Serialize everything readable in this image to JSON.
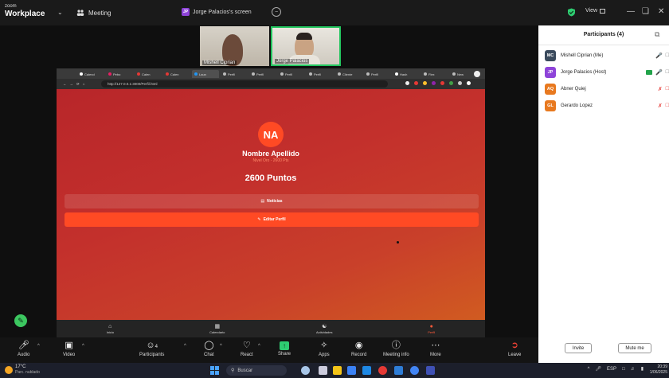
{
  "window": {
    "logo_line1": "zoom",
    "logo_line2": "Workplace",
    "meeting_label": "Meeting",
    "screen_owner_badge": "JP",
    "screen_label": "Jorge Palacios's screen",
    "view_label": "View"
  },
  "thumbnails": [
    {
      "name": "Mishell Ciprian"
    },
    {
      "name": "Jorge Palacios"
    }
  ],
  "browser": {
    "tabs": [
      {
        "label": "Calend"
      },
      {
        "label": "Pebo"
      },
      {
        "label": "Calen"
      },
      {
        "label": "Calen"
      },
      {
        "label": "Laun"
      },
      {
        "label": "Perfil"
      },
      {
        "label": "Perfil"
      },
      {
        "label": "Perfil"
      },
      {
        "label": "Perfil"
      },
      {
        "label": "Cliente"
      },
      {
        "label": "Perfil"
      },
      {
        "label": "Hash"
      },
      {
        "label": "Flex"
      },
      {
        "label": "New"
      }
    ],
    "url": "http://127.0.0.1:3000/Perfil.html"
  },
  "profile": {
    "initials": "NA",
    "name": "Nombre Apellido",
    "level": "Nivel Oro - 2600 Pts",
    "points": "2600 Puntos",
    "news_button": "Noticias",
    "edit_button": "Editar Perfil",
    "nav": [
      {
        "label": "Inicio",
        "icon": "home-icon"
      },
      {
        "label": "Calendario",
        "icon": "calendar-icon"
      },
      {
        "label": "Actividades",
        "icon": "activities-icon"
      },
      {
        "label": "Perfil",
        "icon": "profile-icon",
        "active": true
      }
    ]
  },
  "participants": {
    "title": "Participants (4)",
    "list": [
      {
        "initials": "MC",
        "name": "Mishell Ciprian (Me)",
        "color": "#3a4a5c",
        "muted": false,
        "video": false
      },
      {
        "initials": "JP",
        "name": "Jorge Palacios (Host)",
        "color": "#8e44d9",
        "muted": false,
        "video": true
      },
      {
        "initials": "AQ",
        "name": "Abner Quiej",
        "color": "#e8791f",
        "muted": true,
        "video": false
      },
      {
        "initials": "GL",
        "name": "Gerardo Lopez",
        "color": "#e8791f",
        "muted": true,
        "video": false
      }
    ],
    "invite_button": "Invite",
    "mute_me_button": "Mute me"
  },
  "toolbar": {
    "audio": "Audio",
    "video": "Video",
    "participants": "Participants",
    "participants_count": "4",
    "chat": "Chat",
    "react": "React",
    "share": "Share",
    "apps": "Apps",
    "record": "Record",
    "meeting_info": "Meeting info",
    "more": "More",
    "leave": "Leave"
  },
  "taskbar": {
    "temperature": "17°C",
    "weather": "Parc. nublado",
    "search": "Buscar",
    "language": "ESP",
    "time": "20:39",
    "date": "1/06/2025"
  },
  "colors": {
    "accent_green": "#22c55e",
    "app_orange": "#ff4a24",
    "muted_red": "#e53935"
  }
}
